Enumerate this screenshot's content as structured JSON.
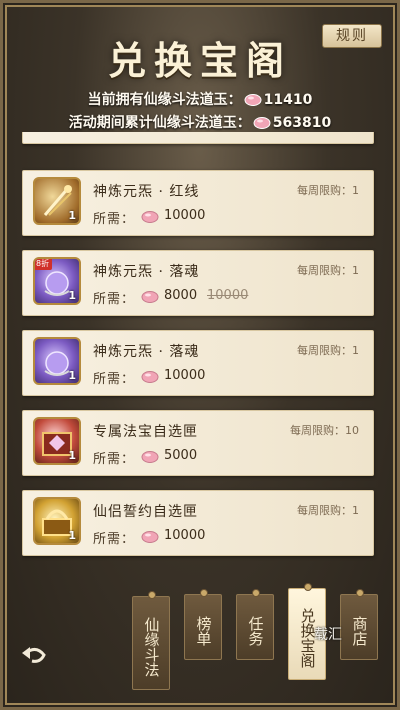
{
  "header": {
    "title": "兑换宝阁",
    "rules_label": "规则",
    "current_jade_label": "当前拥有仙缘斗法道玉：",
    "current_jade_value": "11410",
    "accumulated_jade_label": "活动期间累计仙缘斗法道玉：",
    "accumulated_jade_value": "563810"
  },
  "items": [
    {
      "name": "神炼元炁 · 红线",
      "limit": "每周限购：1",
      "cost_label": "所需：",
      "cost": "10000",
      "count": "1"
    },
    {
      "name": "神炼元炁 · 落魂",
      "limit": "每周限购：1",
      "cost_label": "所需：",
      "cost": "8000",
      "original_cost": "10000",
      "count": "1",
      "tag": "8折"
    },
    {
      "name": "神炼元炁 · 落魂",
      "limit": "每周限购：1",
      "cost_label": "所需：",
      "cost": "10000",
      "count": "1"
    },
    {
      "name": "专属法宝自选匣",
      "limit": "每周限购：10",
      "cost_label": "所需：",
      "cost": "5000",
      "count": "1"
    },
    {
      "name": "仙侣誓约自选匣",
      "limit": "每周限购：1",
      "cost_label": "所需：",
      "cost": "10000",
      "count": "1"
    }
  ],
  "nav": [
    {
      "label": "仙缘斗法",
      "active": false
    },
    {
      "label": "榜单",
      "active": false
    },
    {
      "label": "任务",
      "active": false
    },
    {
      "label": "兑换宝阁",
      "active": true
    },
    {
      "label": "商店",
      "active": false
    }
  ],
  "watermark": "载汇",
  "colors": {
    "gold": "#b58a3c",
    "card_bg": "#f7f0e1",
    "jade": "#e8a0b0"
  },
  "icons": {
    "back": "back-arrow-icon",
    "currency": "jade-gem-icon"
  }
}
